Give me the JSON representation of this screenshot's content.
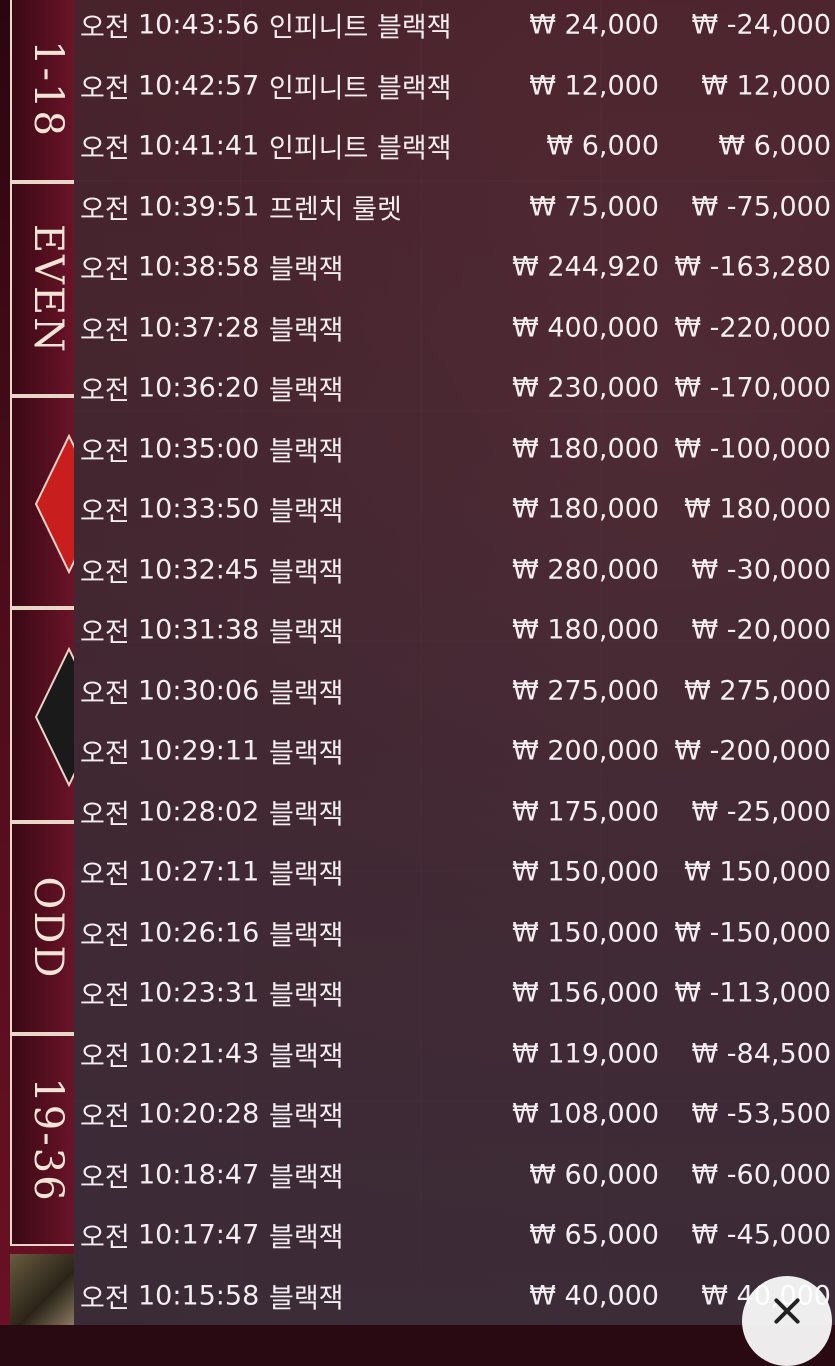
{
  "side_strip": {
    "labels": [
      "1-18",
      "EVEN",
      "ODD",
      "19-36"
    ]
  },
  "history": [
    {
      "ampm": "오전",
      "time": "10:43:56",
      "game": "인피니트 블랙잭",
      "bet": "₩ 24,000",
      "result": "₩ -24,000"
    },
    {
      "ampm": "오전",
      "time": "10:42:57",
      "game": "인피니트 블랙잭",
      "bet": "₩ 12,000",
      "result": "₩ 12,000"
    },
    {
      "ampm": "오전",
      "time": "10:41:41",
      "game": "인피니트 블랙잭",
      "bet": "₩ 6,000",
      "result": "₩ 6,000"
    },
    {
      "ampm": "오전",
      "time": "10:39:51",
      "game": "프렌치 룰렛",
      "bet": "₩ 75,000",
      "result": "₩ -75,000"
    },
    {
      "ampm": "오전",
      "time": "10:38:58",
      "game": "블랙잭",
      "bet": "₩ 244,920",
      "result": "₩ -163,280"
    },
    {
      "ampm": "오전",
      "time": "10:37:28",
      "game": "블랙잭",
      "bet": "₩ 400,000",
      "result": "₩ -220,000"
    },
    {
      "ampm": "오전",
      "time": "10:36:20",
      "game": "블랙잭",
      "bet": "₩ 230,000",
      "result": "₩ -170,000"
    },
    {
      "ampm": "오전",
      "time": "10:35:00",
      "game": "블랙잭",
      "bet": "₩ 180,000",
      "result": "₩ -100,000"
    },
    {
      "ampm": "오전",
      "time": "10:33:50",
      "game": "블랙잭",
      "bet": "₩ 180,000",
      "result": "₩ 180,000"
    },
    {
      "ampm": "오전",
      "time": "10:32:45",
      "game": "블랙잭",
      "bet": "₩ 280,000",
      "result": "₩ -30,000"
    },
    {
      "ampm": "오전",
      "time": "10:31:38",
      "game": "블랙잭",
      "bet": "₩ 180,000",
      "result": "₩ -20,000"
    },
    {
      "ampm": "오전",
      "time": "10:30:06",
      "game": "블랙잭",
      "bet": "₩ 275,000",
      "result": "₩ 275,000"
    },
    {
      "ampm": "오전",
      "time": "10:29:11",
      "game": "블랙잭",
      "bet": "₩ 200,000",
      "result": "₩ -200,000"
    },
    {
      "ampm": "오전",
      "time": "10:28:02",
      "game": "블랙잭",
      "bet": "₩ 175,000",
      "result": "₩ -25,000"
    },
    {
      "ampm": "오전",
      "time": "10:27:11",
      "game": "블랙잭",
      "bet": "₩ 150,000",
      "result": "₩ 150,000"
    },
    {
      "ampm": "오전",
      "time": "10:26:16",
      "game": "블랙잭",
      "bet": "₩ 150,000",
      "result": "₩ -150,000"
    },
    {
      "ampm": "오전",
      "time": "10:23:31",
      "game": "블랙잭",
      "bet": "₩ 156,000",
      "result": "₩ -113,000"
    },
    {
      "ampm": "오전",
      "time": "10:21:43",
      "game": "블랙잭",
      "bet": "₩ 119,000",
      "result": "₩ -84,500"
    },
    {
      "ampm": "오전",
      "time": "10:20:28",
      "game": "블랙잭",
      "bet": "₩ 108,000",
      "result": "₩ -53,500"
    },
    {
      "ampm": "오전",
      "time": "10:18:47",
      "game": "블랙잭",
      "bet": "₩ 60,000",
      "result": "₩ -60,000"
    },
    {
      "ampm": "오전",
      "time": "10:17:47",
      "game": "블랙잭",
      "bet": "₩ 65,000",
      "result": "₩ -45,000"
    },
    {
      "ampm": "오전",
      "time": "10:15:58",
      "game": "블랙잭",
      "bet": "₩ 40,000",
      "result": "₩ 40,000"
    }
  ],
  "colors": {
    "text": "#f4eef0",
    "red_diamond": "#c81e1e",
    "black_diamond": "#1a1a1a"
  },
  "icons": {
    "close": "close-icon"
  }
}
